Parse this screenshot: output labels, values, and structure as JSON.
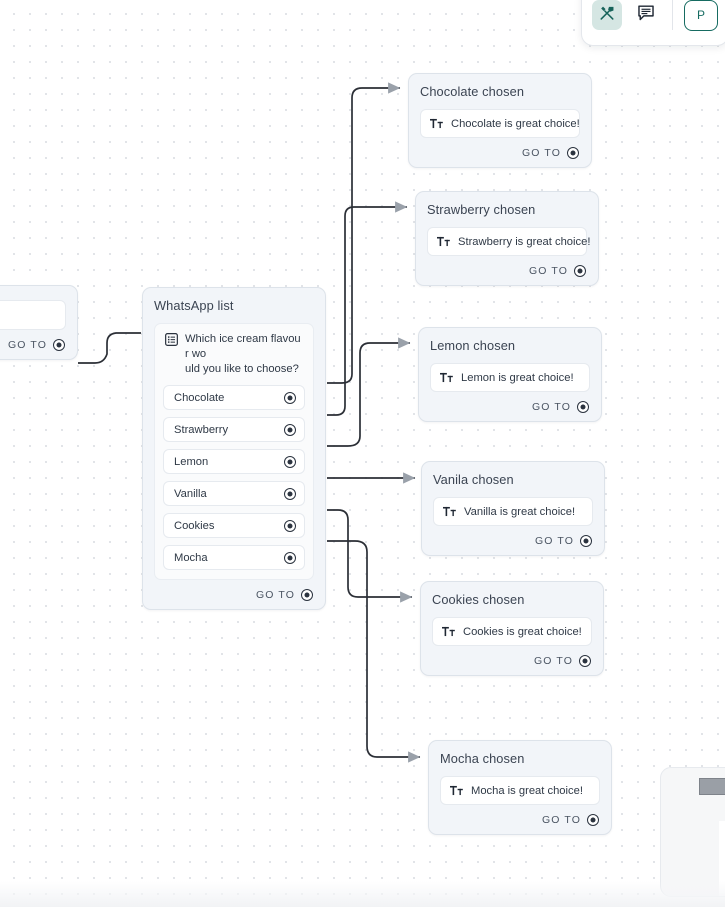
{
  "app": {
    "canvas_name": "flow-canvas",
    "grid": "dot-grid"
  },
  "toolbar": {
    "tools_button_label": "",
    "tools_icon": "crossed-tools-icon",
    "comments_icon": "comment-icon",
    "primary_button_label": "P",
    "accent_color": "#166b61",
    "active_bg": "#d5e6e3"
  },
  "goto": {
    "label": "GO TO",
    "icon": "target-dot-icon"
  },
  "nodes": {
    "partial_left": {
      "goto_label": "GO TO"
    },
    "whatsapp_list": {
      "title": "WhatsApp list",
      "prompt_icon": "list-icon",
      "prompt": "Which ice cream flavour would you like to choose?",
      "prompt_line1": "Which ice cream flavour wo",
      "prompt_line2": "uld you like to choose?",
      "options": [
        {
          "label": "Chocolate"
        },
        {
          "label": "Strawberry"
        },
        {
          "label": "Lemon"
        },
        {
          "label": "Vanilla"
        },
        {
          "label": "Cookies"
        },
        {
          "label": "Mocha"
        }
      ],
      "goto_label": "GO TO"
    },
    "chosen": [
      {
        "id": "chocolate",
        "title": "Chocolate chosen",
        "message_icon": "text-format-icon",
        "message": "Chocolate is great choice!",
        "goto_label": "GO TO"
      },
      {
        "id": "strawberry",
        "title": "Strawberry chosen",
        "message_icon": "text-format-icon",
        "message": "Strawberry is great choice!",
        "goto_label": "GO TO"
      },
      {
        "id": "lemon",
        "title": "Lemon chosen",
        "message_icon": "text-format-icon",
        "message": "Lemon is great choice!",
        "goto_label": "GO TO"
      },
      {
        "id": "vanilla",
        "title": "Vanila chosen",
        "message_icon": "text-format-icon",
        "message": "Vanilla is great choice!",
        "goto_label": "GO TO"
      },
      {
        "id": "cookies",
        "title": "Cookies chosen",
        "message_icon": "text-format-icon",
        "message": "Cookies is great choice!",
        "goto_label": "GO TO"
      },
      {
        "id": "mocha",
        "title": "Mocha chosen",
        "message_icon": "text-format-icon",
        "message": "Mocha is great choice!",
        "goto_label": "GO TO"
      }
    ]
  }
}
